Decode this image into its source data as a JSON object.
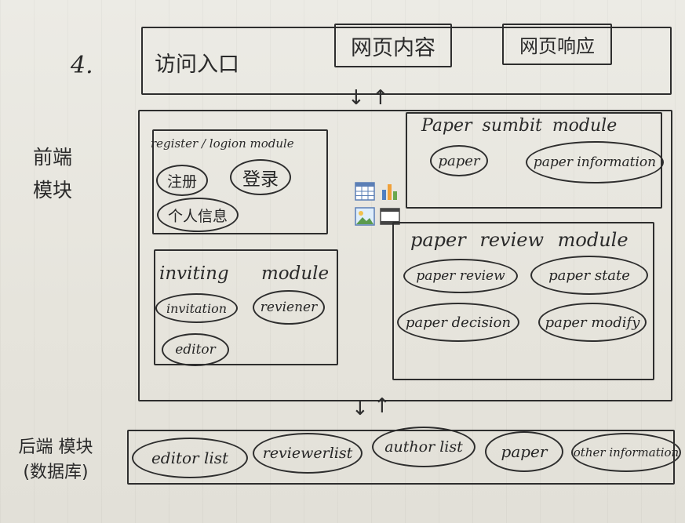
{
  "step_number": "4.",
  "top": {
    "entry": "访问入口",
    "content": "网页内容",
    "response": "网页响应"
  },
  "arrows": {
    "down": "↓",
    "up": "↑"
  },
  "frontend": {
    "side_label": "前端 模块",
    "register": {
      "title": "register / logion module",
      "items": [
        "注册",
        "登录",
        "个人信息"
      ]
    },
    "inviting": {
      "title": "inviting module",
      "items": [
        "invitation",
        "reviener",
        "editor"
      ]
    },
    "submit": {
      "title": "Paper sumbit module",
      "items": [
        "paper",
        "paper information"
      ]
    },
    "review": {
      "title": "paper review module",
      "items": [
        "paper review",
        "paper state",
        "paper decision",
        "paper modify"
      ]
    }
  },
  "backend": {
    "side_label": "后端 模块 (数据库)",
    "items": [
      "editor list",
      "reviewerlist",
      "author list",
      "paper",
      "other information"
    ]
  },
  "icons": [
    "table-icon",
    "bar-chart-icon",
    "image-icon",
    "film-icon"
  ]
}
